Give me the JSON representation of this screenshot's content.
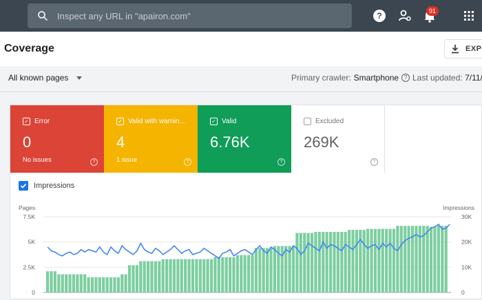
{
  "topbar": {
    "search_placeholder": "Inspect any URL in \"apairon.com\"",
    "icons": [
      "search-icon",
      "help-icon",
      "manage-users-icon",
      "notifications-icon",
      "apps-grid-icon"
    ],
    "notification_count": "91"
  },
  "header": {
    "title": "Coverage",
    "export_label": "EXPO"
  },
  "filters": {
    "pages_selector": "All known pages",
    "crawler_label": "Primary crawler:",
    "crawler_value": "Smartphone",
    "updated_label": "Last updated:",
    "updated_value": "7/11/"
  },
  "cards": [
    {
      "label": "Error",
      "value": "0",
      "sub": "No issues",
      "color": "#db4437",
      "checked": true
    },
    {
      "label": "Valid with warnin...",
      "value": "4",
      "sub": "1 issue",
      "color": "#f4b400",
      "checked": true
    },
    {
      "label": "Valid",
      "value": "6.76K",
      "sub": "",
      "color": "#0f9d58",
      "checked": true
    },
    {
      "label": "Excluded",
      "value": "269K",
      "sub": "",
      "color": "#ffffff",
      "checked": false
    }
  ],
  "impressions_toggle": "Impressions",
  "chart_data": {
    "type": "bar",
    "left_axis": {
      "label": "Pages",
      "ticks": [
        "7.5K",
        "5K",
        "2.5K",
        "0"
      ],
      "ylim": [
        0,
        7500
      ]
    },
    "right_axis": {
      "label": "Impressions",
      "ticks": [
        "30K",
        "20K",
        "10K",
        "0"
      ],
      "ylim": [
        0,
        30000
      ]
    },
    "series": [
      {
        "name": "Valid",
        "type": "bar",
        "color": "#7dcea0",
        "values": [
          2100,
          2100,
          2100,
          1800,
          1800,
          1800,
          1800,
          1800,
          1800,
          1800,
          1800,
          1500,
          1500,
          1500,
          1500,
          1500,
          1500,
          1500,
          1500,
          1500,
          1800,
          1800,
          2700,
          2700,
          2700,
          3100,
          3100,
          3100,
          3100,
          3100,
          3100,
          3300,
          3300,
          3300,
          3300,
          3300,
          3300,
          3300,
          3300,
          3300,
          3300,
          3300,
          3300,
          3300,
          3300,
          3500,
          3500,
          3500,
          3500,
          3500,
          3500,
          3700,
          3700,
          3700,
          3700,
          3700,
          4400,
          4400,
          4400,
          4400,
          4400,
          4600,
          4600,
          4600,
          4600,
          4600,
          4600,
          5900,
          5900,
          5900,
          5900,
          5900,
          6000,
          6000,
          6000,
          6000,
          6000,
          6000,
          6000,
          6000,
          6000,
          6200,
          6200,
          6200,
          6200,
          6200,
          6300,
          6300,
          6300,
          6300,
          6300,
          6300,
          6300,
          6300,
          6600,
          6600,
          6600,
          6600,
          6600,
          6600,
          6600,
          6600,
          6600,
          6500,
          6500,
          6600,
          6600,
          6600
        ]
      },
      {
        "name": "Impressions",
        "type": "line",
        "color": "#4285f4",
        "values": [
          18000,
          16500,
          16000,
          15000,
          14500,
          15500,
          16000,
          15000,
          15500,
          17000,
          16000,
          17000,
          16500,
          16000,
          18000,
          16000,
          15000,
          18000,
          16500,
          15500,
          18500,
          17000,
          16000,
          15000,
          16500,
          19500,
          17000,
          16000,
          15500,
          17500,
          16500,
          15000,
          16000,
          17000,
          18500,
          17000,
          15500,
          16500,
          17000,
          15000,
          15500,
          16000,
          17500,
          16500,
          15500,
          14500,
          13500,
          15500,
          16000,
          17000,
          14500,
          15500,
          16500,
          17000,
          16000,
          15000,
          17000,
          18500,
          16500,
          15500,
          18000,
          17000,
          15500,
          14500,
          17000,
          16000,
          18500,
          17500,
          15000,
          16500,
          19500,
          18500,
          17500,
          16500,
          20000,
          17500,
          19000,
          18500,
          17500,
          16500,
          19000,
          18000,
          17000,
          19000,
          21000,
          19000,
          17500,
          18500,
          19000,
          17000,
          19500,
          18000,
          19500,
          17500,
          16500,
          19000,
          20500,
          21500,
          22000,
          23000,
          22000,
          22500,
          24000,
          25500,
          26000,
          27000,
          25000,
          25500,
          27000
        ]
      }
    ]
  }
}
